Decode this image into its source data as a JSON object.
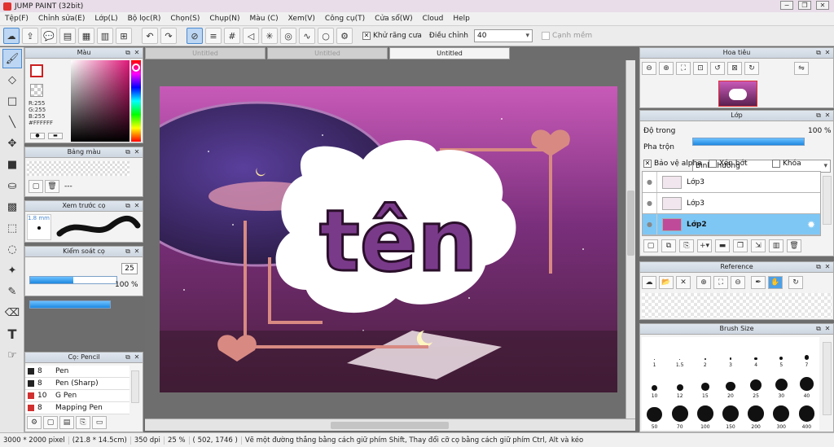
{
  "app": {
    "title": "JUMP PAINT (32bit)",
    "win_min": "−",
    "win_max": "❐",
    "win_close": "✕"
  },
  "menu": [
    "Tệp(F)",
    "Chỉnh sửa(E)",
    "Lớp(L)",
    "Bộ lọc(R)",
    "Chọn(S)",
    "Chụp(N)",
    "Màu (C)",
    "Xem(V)",
    "Công cụ(T)",
    "Cửa sổ(W)",
    "Cloud",
    "Help"
  ],
  "toolbar": {
    "antialias_label": "Khử răng cưa",
    "adjust_label": "Điều chỉnh",
    "adjust_value": "40",
    "clipping_label": "Cạnh mềm"
  },
  "tabs": [
    "Untitled",
    "Untitled",
    "Untitled"
  ],
  "color_panel": {
    "title": "Màu",
    "r": "R:255",
    "g": "G:255",
    "b": "B:255",
    "hex": "#FFFFFF"
  },
  "swatch_panel": {
    "title": "Bảng màu",
    "dashes": "---"
  },
  "brush_preview": {
    "title": "Xem trước cọ",
    "size": "1.8 mm"
  },
  "brush_control": {
    "title": "Kiểm soát cọ",
    "size_value": "25",
    "opacity_value": "100 %",
    "size_level": 0.5,
    "opacity_level": 1.0
  },
  "brush_list": {
    "title": "Cọ: Pencil",
    "items": [
      {
        "size": "8",
        "name": "Pen",
        "color": "#222222"
      },
      {
        "size": "8",
        "name": "Pen (Sharp)",
        "color": "#222222"
      },
      {
        "size": "10",
        "name": "G Pen",
        "color": "#d03030"
      },
      {
        "size": "8",
        "name": "Mapping Pen",
        "color": "#d03030"
      }
    ]
  },
  "navigator": {
    "title": "Hoa tiêu"
  },
  "layers": {
    "title": "Lớp",
    "opacity_label": "Độ trong",
    "opacity_value": "100 %",
    "opacity_level": 1.0,
    "blend_label": "Pha trộn",
    "blend_value": "Bình thường",
    "protect_alpha": "Bảo vệ alpha",
    "clip": "Xén bớt",
    "lock": "Khóa",
    "items": [
      {
        "name": "Lớp3",
        "selected": false
      },
      {
        "name": "Lớp3",
        "selected": false
      },
      {
        "name": "Lớp2",
        "selected": true
      }
    ]
  },
  "reference": {
    "title": "Reference"
  },
  "brush_size": {
    "title": "Brush Size",
    "row1": [
      "1",
      "1.5",
      "2",
      "3",
      "4",
      "5",
      "7"
    ],
    "row2": [
      "10",
      "12",
      "15",
      "20",
      "25",
      "30",
      "40"
    ],
    "row3": [
      "50",
      "70",
      "100",
      "150",
      "200",
      "300",
      "400"
    ]
  },
  "artwork": {
    "text": "tên"
  },
  "status": {
    "size": "3000 * 2000 pixel",
    "physical": "(21.8 * 14.5cm)",
    "dpi": "350 dpi",
    "zoom": "25 %",
    "coords": "( 502, 1746 )",
    "hint": "Vẽ một đường thẳng bằng cách giữ phím Shift, Thay đổi cỡ cọ bằng cách giữ phím Ctrl, Alt và kéo"
  },
  "colors": {
    "accent": "#4a8ad0",
    "selected_layer": "#7ec7f5",
    "primary_color": "#cc2020",
    "secondary_color": "#ffffff"
  }
}
